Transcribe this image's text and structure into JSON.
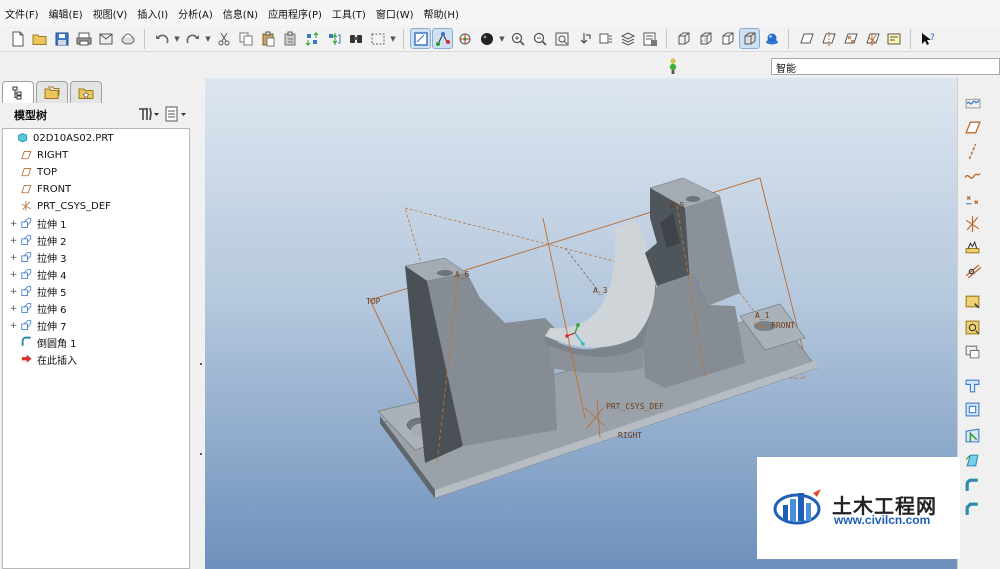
{
  "menu": [
    "文件(F)",
    "编辑(E)",
    "视图(V)",
    "插入(I)",
    "分析(A)",
    "信息(N)",
    "应用程序(P)",
    "工具(T)",
    "窗口(W)",
    "帮助(H)"
  ],
  "toolbar": {
    "icons": [
      "new-icon",
      "open-icon",
      "save-icon",
      "print-icon",
      "send-icon",
      "shading-icon",
      "undo-icon",
      "redo-icon",
      "cut-icon",
      "copy-icon",
      "paste-icon",
      "paste-special-icon",
      "regenerate-icon",
      "regen-manager-icon",
      "find-icon",
      "select-box-icon",
      "view-display-icon",
      "datum-display-icon",
      "spin-center-icon",
      "appearance-icon",
      "zoom-in-icon",
      "zoom-out-icon",
      "refit-icon",
      "reorient-icon",
      "saved-views-icon",
      "layers-icon",
      "view-manager-icon",
      "wireframe-icon",
      "hidden-line-icon",
      "no-hidden-icon",
      "shading-mode-icon",
      "enhanced-realism-icon",
      "datum-planes-icon",
      "datum-axes-icon",
      "datum-points-icon",
      "coordinate-systems-icon",
      "annotations-icon",
      "context-help-icon"
    ]
  },
  "filter": {
    "value": "智能"
  },
  "left_panel": {
    "tree_title": "模型树",
    "items": [
      {
        "label": "02D10AS02.PRT",
        "icon": "part-icon",
        "expander": ""
      },
      {
        "label": "RIGHT",
        "icon": "datum-plane-icon",
        "expander": ""
      },
      {
        "label": "TOP",
        "icon": "datum-plane-icon",
        "expander": ""
      },
      {
        "label": "FRONT",
        "icon": "datum-plane-icon",
        "expander": ""
      },
      {
        "label": "PRT_CSYS_DEF",
        "icon": "coordinate-system-icon",
        "expander": ""
      },
      {
        "label": "拉伸 1",
        "icon": "extrude-icon",
        "expander": "+"
      },
      {
        "label": "拉伸 2",
        "icon": "extrude-icon",
        "expander": "+"
      },
      {
        "label": "拉伸 3",
        "icon": "extrude-icon",
        "expander": "+"
      },
      {
        "label": "拉伸 4",
        "icon": "extrude-icon",
        "expander": "+"
      },
      {
        "label": "拉伸 5",
        "icon": "extrude-icon",
        "expander": "+"
      },
      {
        "label": "拉伸 6",
        "icon": "extrude-icon",
        "expander": "+"
      },
      {
        "label": "拉伸 7",
        "icon": "extrude-icon",
        "expander": "+"
      },
      {
        "label": "倒圆角 1",
        "icon": "round-icon",
        "expander": ""
      },
      {
        "label": "在此插入",
        "icon": "insert-here-icon",
        "expander": ""
      }
    ]
  },
  "viewport": {
    "datum_labels": {
      "top": "TOP",
      "front": "FRONT",
      "right": "RIGHT",
      "csys": "PRT_CSYS_DEF",
      "a6": "A_6",
      "a5": "A_5",
      "a3": "A_3",
      "a1": "A_1"
    }
  },
  "right_toolbar": {
    "icons": [
      "sketch-tool-icon",
      "datum-plane-tool-icon",
      "datum-axis-tool-icon",
      "datum-curve-tool-icon",
      "datum-point-tool-icon",
      "csys-tool-icon",
      "analysis-feature-icon",
      "sketched-datum-icon",
      "sketch-icon",
      "sketch-palette-icon",
      "edit-sketch-icon",
      "hole-icon",
      "shell-icon",
      "rib-icon",
      "draft-icon",
      "round-tool-icon",
      "chamfer-icon"
    ]
  },
  "watermark": {
    "title": "土木工程网",
    "url": "www.civilcn.com"
  },
  "colors": {
    "viewport_top": "#dde6ef",
    "viewport_bottom": "#6e90bc",
    "model": "#8e969d",
    "datum": "#b86a30"
  }
}
